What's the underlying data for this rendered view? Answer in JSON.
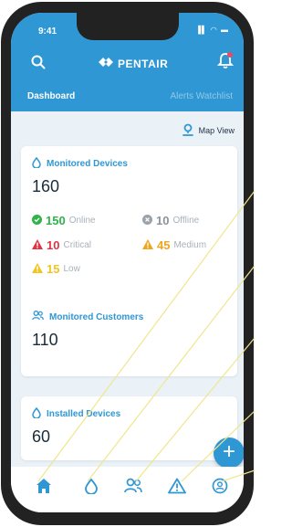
{
  "status": {
    "time": "9:41",
    "indicators": "▐▌ ◠ ▬"
  },
  "header": {
    "search_icon": "search-icon",
    "brand": "PENTAIR",
    "notification_icon": "bell-icon",
    "accent_color": "#2f97d3"
  },
  "tabs": [
    {
      "label": "Dashboard",
      "active": true
    },
    {
      "label": "Alerts Watchlist",
      "active": false
    }
  ],
  "map_view": {
    "label": "Map View",
    "icon": "map-pin-icon"
  },
  "monitored": {
    "title": "Monitored Devices",
    "count": "160",
    "online": {
      "value": "150",
      "label": "Online",
      "color": "#2fb34a"
    },
    "offline": {
      "value": "10",
      "label": "Offline",
      "color": "#a8b2ba"
    },
    "critical": {
      "value": "10",
      "label": "Critical",
      "color": "#e03444"
    },
    "medium": {
      "value": "45",
      "label": "Medium",
      "color": "#f2a51e"
    },
    "low": {
      "value": "15",
      "label": "Low",
      "color": "#f2c41e"
    }
  },
  "customers": {
    "title": "Monitored Customers",
    "count": "110"
  },
  "installed": {
    "title": "Installed Devices",
    "count": "60"
  },
  "fab": {
    "label": "+"
  },
  "nav": [
    {
      "name": "home",
      "icon": "home-icon"
    },
    {
      "name": "devices",
      "icon": "droplet-icon"
    },
    {
      "name": "customers",
      "icon": "users-icon"
    },
    {
      "name": "alerts",
      "icon": "warning-icon"
    },
    {
      "name": "profile",
      "icon": "user-circle-icon"
    }
  ]
}
